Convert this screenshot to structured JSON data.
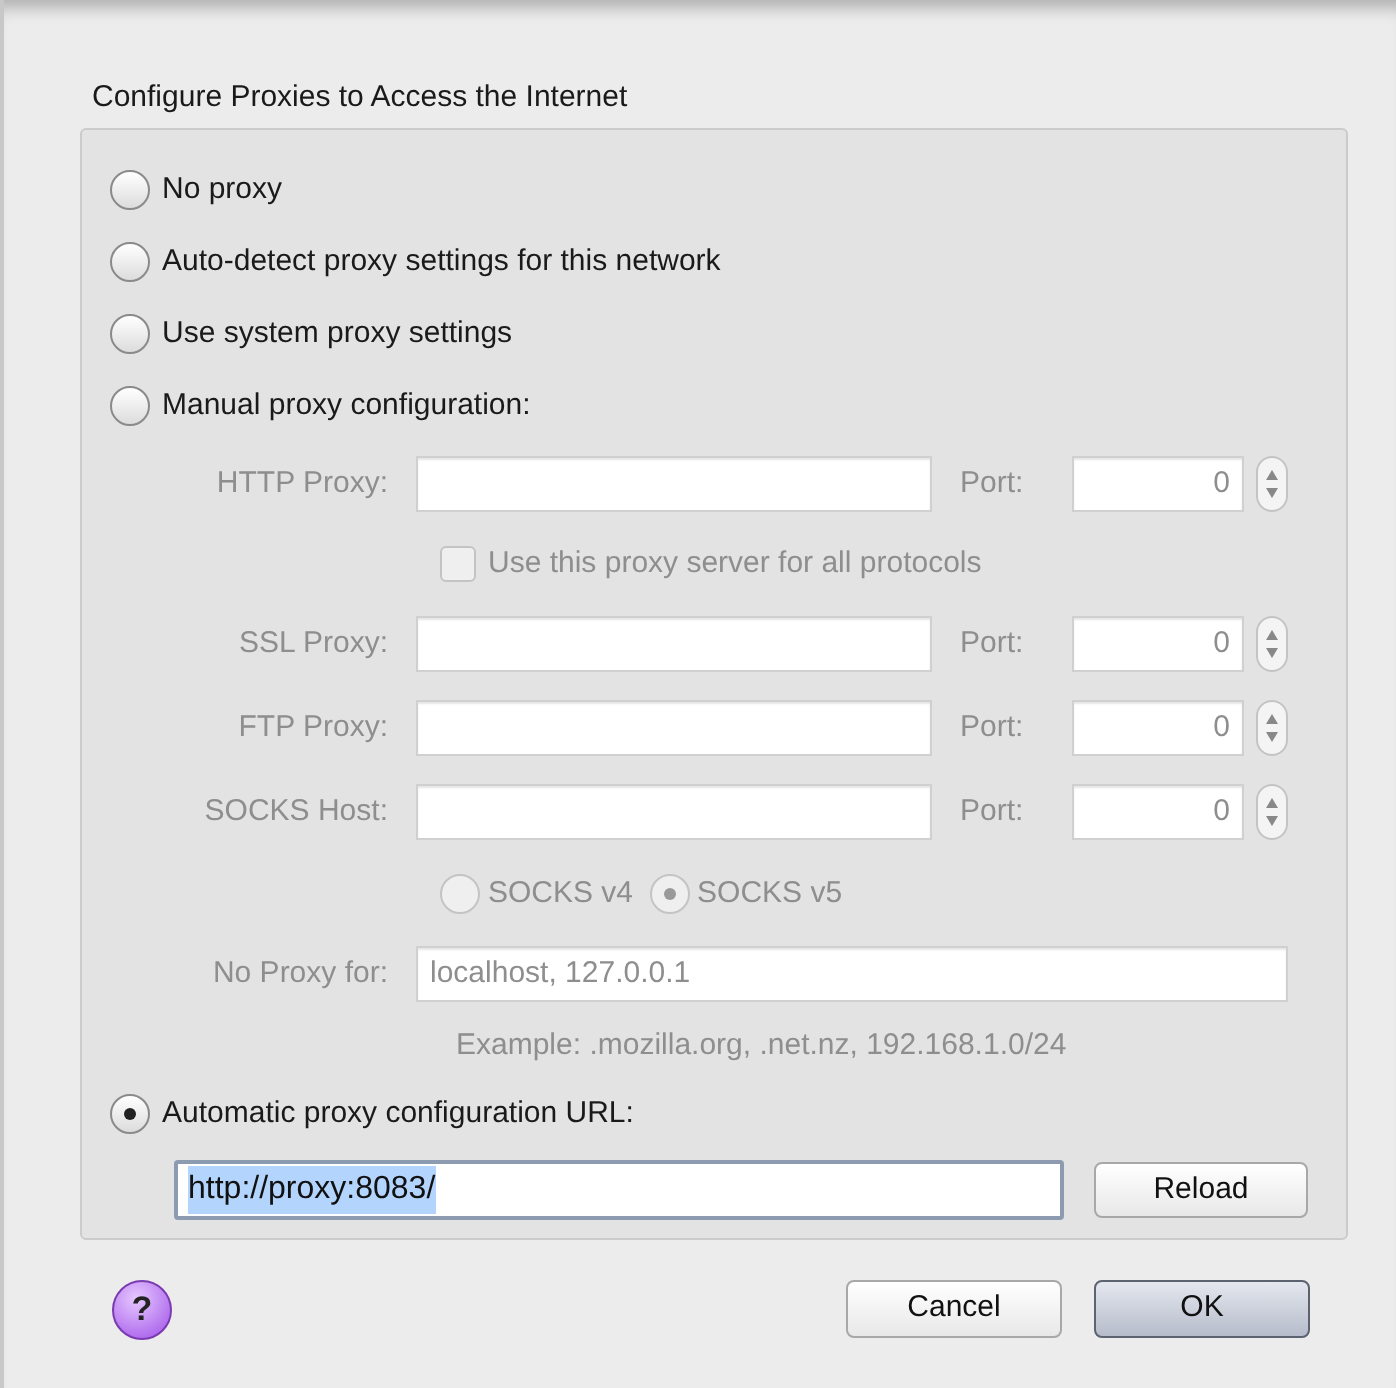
{
  "title": "Configure Proxies to Access the Internet",
  "modes": [
    {
      "kind": "simple",
      "label": "No proxy",
      "selected": false
    },
    {
      "kind": "simple",
      "label": "Auto-detect proxy settings for this network",
      "selected": false
    },
    {
      "kind": "simple",
      "label": "Use system proxy settings",
      "selected": false
    },
    {
      "kind": "manual",
      "label": "Manual proxy configuration:",
      "selected": false
    },
    {
      "kind": "auto",
      "label": "Automatic proxy configuration URL:",
      "selected": true
    }
  ],
  "manual": {
    "disabled": true,
    "proxies": [
      {
        "label": "HTTP Proxy:",
        "port_label": "Port:",
        "port": "0"
      },
      {
        "label": "SSL Proxy:",
        "port_label": "Port:",
        "port": "0"
      },
      {
        "label": "FTP Proxy:",
        "port_label": "Port:",
        "port": "0"
      },
      {
        "label": "SOCKS Host:",
        "port_label": "Port:",
        "port": "0"
      }
    ],
    "share_all": {
      "label": "Use this proxy server for all protocols",
      "checked": false
    },
    "socks_versions": [
      {
        "label": "SOCKS v4",
        "selected": false
      },
      {
        "label": "SOCKS v5",
        "selected": true
      }
    ],
    "no_proxy": {
      "label": "No Proxy for:",
      "value": "localhost, 127.0.0.1"
    },
    "example": "Example: .mozilla.org, .net.nz, 192.168.1.0/24"
  },
  "auto_url": {
    "value": "http://proxy:8083/",
    "text_selected": true,
    "reload": "Reload"
  },
  "help": "?",
  "buttons": [
    {
      "label": "Cancel",
      "default": false
    },
    {
      "label": "OK",
      "default": true
    }
  ]
}
